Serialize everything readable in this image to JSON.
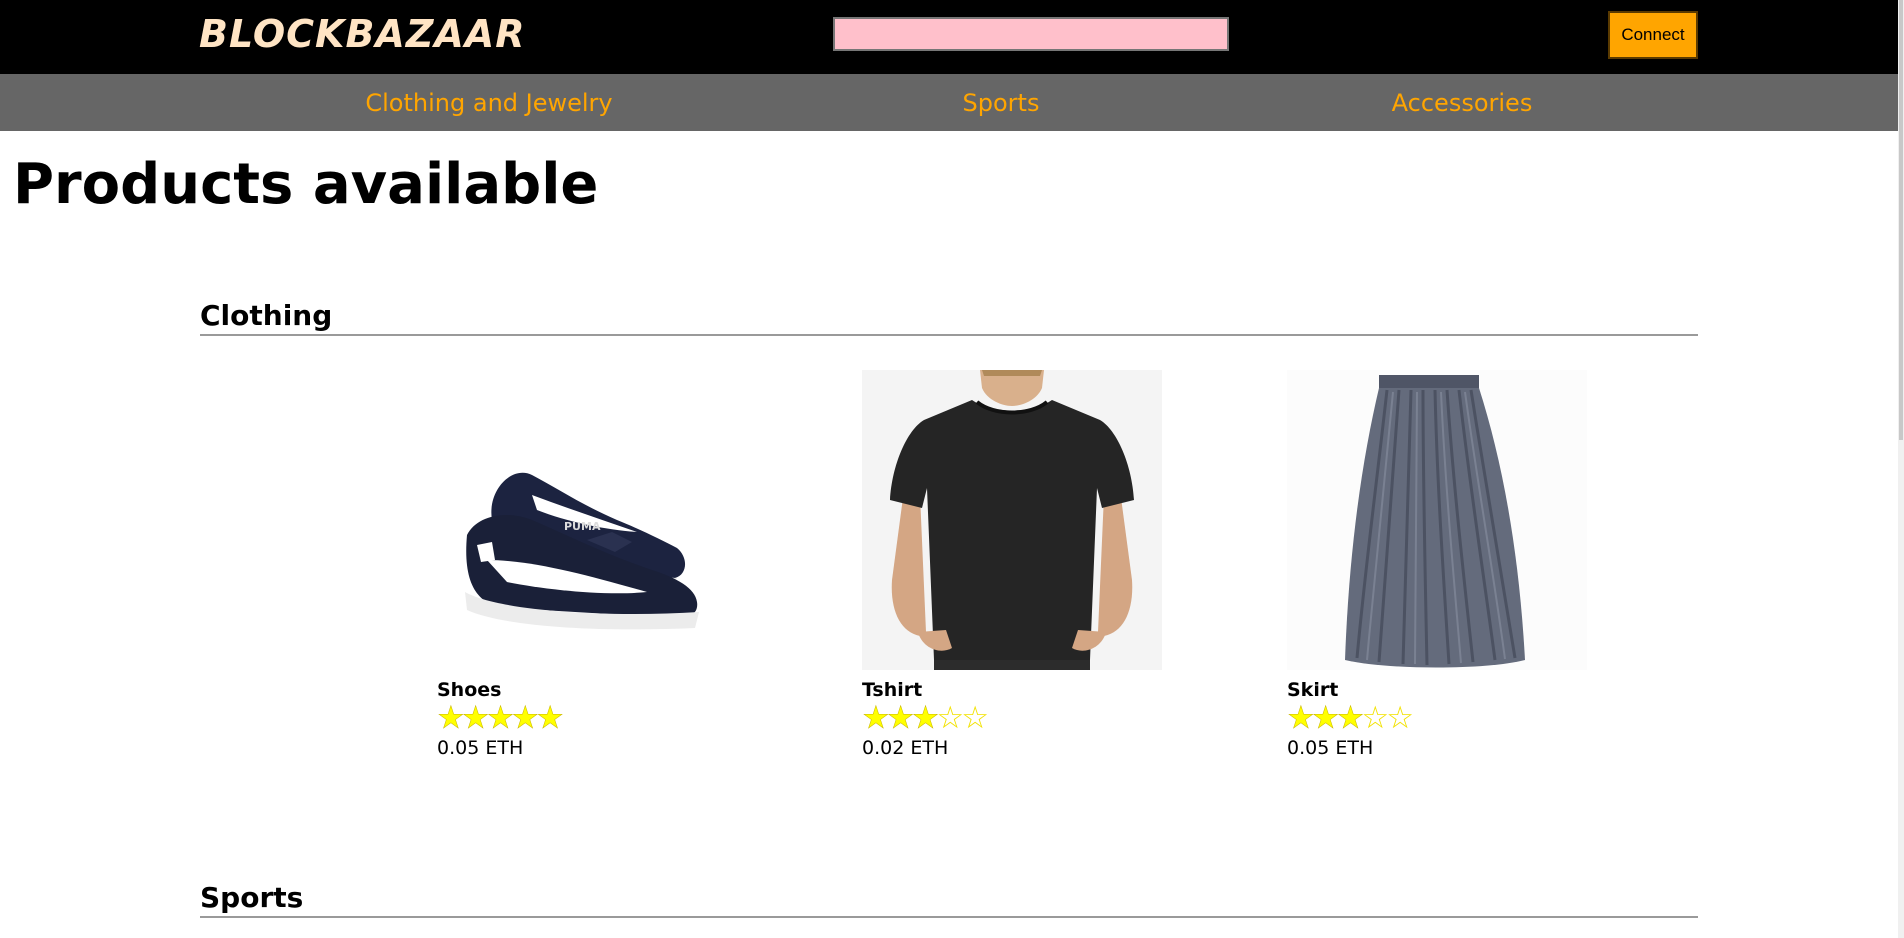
{
  "header": {
    "logo": "BLOCKBAZAAR",
    "search_placeholder": "",
    "connect_label": "Connect"
  },
  "nav": {
    "items": [
      {
        "label": "Clothing and Jewelry"
      },
      {
        "label": "Sports"
      },
      {
        "label": "Accessories"
      }
    ]
  },
  "main": {
    "title": "Products available",
    "sections": [
      {
        "heading": "Clothing",
        "products": [
          {
            "name": "Shoes",
            "rating": 5,
            "rating_max": 5,
            "price": "0.05 ETH",
            "image": "navy-sneakers-image"
          },
          {
            "name": "Tshirt",
            "rating": 3,
            "rating_max": 5,
            "price": "0.02 ETH",
            "image": "black-tshirt-image"
          },
          {
            "name": "Skirt",
            "rating": 3,
            "rating_max": 5,
            "price": "0.05 ETH",
            "image": "grey-skirt-image"
          }
        ]
      },
      {
        "heading": "Sports"
      }
    ]
  },
  "colors": {
    "topbar": "#000000",
    "logo": "#ffe4c4",
    "search_bg": "#ffc0cb",
    "connect_bg": "#ffa500",
    "navbar": "#666666",
    "nav_text": "#ffa500",
    "star": "#ffff00"
  }
}
